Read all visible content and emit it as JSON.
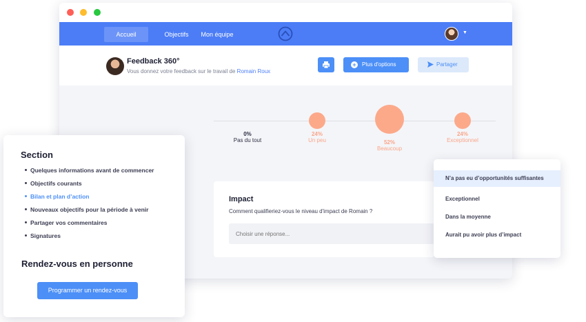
{
  "nav": {
    "home": "Accueil",
    "objectives": "Objectifs",
    "team": "Mon équipe"
  },
  "feedback": {
    "title": "Feedback 360°",
    "subtitle": "Vous donnez votre feedback sur le travail de",
    "person": "Romain Roux",
    "more_options": "Plus d'options",
    "share": "Partager"
  },
  "scale": [
    {
      "pct": "0%",
      "label": "Pas du tout",
      "value": 0
    },
    {
      "pct": "24%",
      "label": "Un peu",
      "value": 24
    },
    {
      "pct": "52%",
      "label": "Beaucoup",
      "value": 52
    },
    {
      "pct": "24%",
      "label": "Exceptionnel",
      "value": 24
    }
  ],
  "impact": {
    "title": "Impact",
    "question": "Comment qualifieriez-vous le niveau d'impact de Romain ?",
    "placeholder": "Choisir une réponse..."
  },
  "dropdown": [
    "N’a pas eu d’opportunités suffisantes",
    "Exceptionnel",
    "Dans la moyenne",
    "Aurait pu avoir plus d’impact"
  ],
  "section": {
    "title": "Section",
    "items": [
      "Quelques informations avant de commencer",
      "Objectifs courants",
      "Bilan et plan d’action",
      "Nouveaux objectifs pour la période à venir",
      "Partager vos commentaires",
      "Signatures"
    ],
    "meeting_title": "Rendez-vous en personne",
    "meeting_button": "Programmer un rendez-vous"
  },
  "colors": {
    "brand_blue": "#4c7df7",
    "button_blue": "#4c8ff7",
    "accent_orange": "#fca98a"
  }
}
